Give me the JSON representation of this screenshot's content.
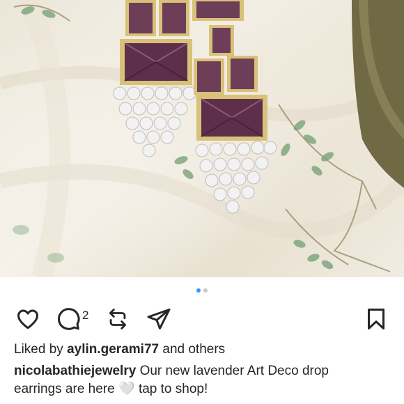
{
  "post": {
    "carousel": {
      "total": 2,
      "active": 1
    },
    "photo_alt": "Lavender art deco drop earrings on a floral chiffon fabric"
  },
  "actions": {
    "like_icon": "heart-icon",
    "comment_icon": "comment-icon",
    "comment_count": "2",
    "repost_icon": "repost-icon",
    "share_icon": "send-icon",
    "save_icon": "bookmark-icon"
  },
  "likes": {
    "prefix": "Liked by",
    "username": "aylin.gerami77",
    "suffix": "and others"
  },
  "caption": {
    "username": "nicolabathiejewelry",
    "text_before": "Our new lavender Art Deco drop earrings are here",
    "emoji": "🤍",
    "text_after": "tap to shop!"
  },
  "colors": {
    "accent": "#3897f0",
    "text": "#262626",
    "stone": "#6a3a52",
    "gold": "#c9b26a"
  }
}
